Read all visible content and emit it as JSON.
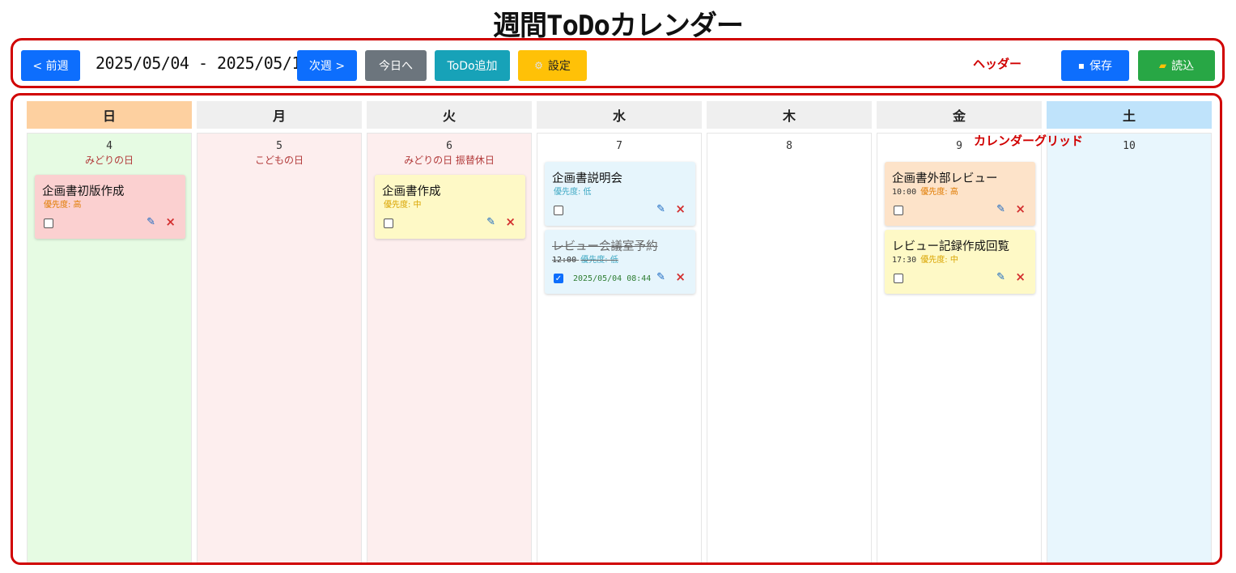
{
  "title": "週間ToDoカレンダー",
  "header": {
    "prev_label": "< 前週",
    "range": "2025/05/04 - 2025/05/10",
    "next_label": "次週 >",
    "today_label": "今日へ",
    "add_label": "ToDo追加",
    "settings_label": "設定",
    "save_label": "保存",
    "load_label": "読込",
    "annotation": "ヘッダー"
  },
  "calendar": {
    "annotation": "カレンダーグリッド",
    "weekdays": [
      "日",
      "月",
      "火",
      "水",
      "木",
      "金",
      "土"
    ],
    "days": [
      {
        "num": "4",
        "holiday": "みどりの日"
      },
      {
        "num": "5",
        "holiday": "こどもの日"
      },
      {
        "num": "6",
        "holiday": "みどりの日 振替休日"
      },
      {
        "num": "7",
        "holiday": ""
      },
      {
        "num": "8",
        "holiday": ""
      },
      {
        "num": "9",
        "holiday": ""
      },
      {
        "num": "10",
        "holiday": ""
      }
    ]
  },
  "tasks": {
    "sun_1": {
      "title": "企画書初版作成",
      "priority": "優先度: 高"
    },
    "tue_1": {
      "title": "企画書作成",
      "priority": "優先度: 中"
    },
    "wed_1": {
      "title": "企画書説明会",
      "priority": "優先度: 低"
    },
    "wed_2": {
      "title": "レビュー会議室予約",
      "time": "12:00",
      "priority": "優先度: 低",
      "completed_at": "2025/05/04 08:44"
    },
    "fri_1": {
      "title": "企画書外部レビュー",
      "time": "10:00",
      "priority": "優先度: 高"
    },
    "fri_2": {
      "title": "レビュー記録作成回覧",
      "time": "17:30",
      "priority": "優先度: 中"
    }
  },
  "colors": {
    "annotation_red": "#d00000",
    "primary": "#0d6efd",
    "priority_high": "#e07b00",
    "priority_mid": "#d9a400",
    "priority_low": "#3fa9c4"
  },
  "icons": [
    "save-icon",
    "folder-icon",
    "gear-icon",
    "pencil-icon",
    "close-icon",
    "checkbox-icon"
  ]
}
